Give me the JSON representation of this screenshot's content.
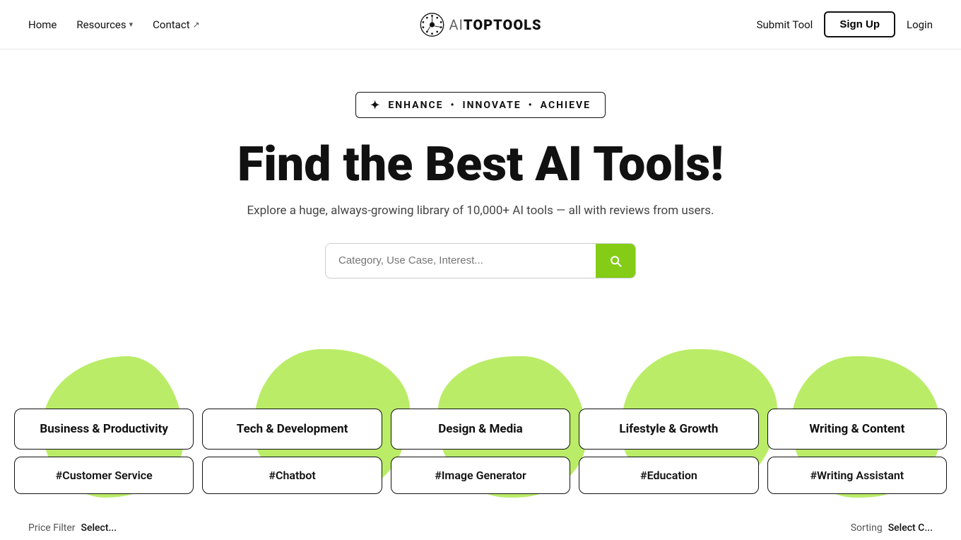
{
  "nav": {
    "home_label": "Home",
    "resources_label": "Resources",
    "contact_label": "Contact",
    "submit_tool_label": "Submit Tool",
    "signup_label": "Sign Up",
    "login_label": "Login",
    "logo_text": "AITOPTOOLS"
  },
  "hero": {
    "badge_icon": "✦",
    "badge_word1": "ENHANCE",
    "badge_dot1": "•",
    "badge_word2": "INNOVATE",
    "badge_dot2": "•",
    "badge_word3": "ACHIEVE",
    "title": "Find the Best AI Tools!",
    "subtitle": "Explore a huge, always-growing library of 10,000+ AI tools — all with reviews from users.",
    "search_placeholder": "Category, Use Case, Interest..."
  },
  "categories": {
    "row1": [
      {
        "label": "Business & Productivity"
      },
      {
        "label": "Tech & Development"
      },
      {
        "label": "Design & Media"
      },
      {
        "label": "Lifestyle & Growth"
      },
      {
        "label": "Writing & Content"
      }
    ],
    "row2": [
      {
        "label": "#Customer Service"
      },
      {
        "label": "#Chatbot"
      },
      {
        "label": "#Image Generator"
      },
      {
        "label": "#Education"
      },
      {
        "label": "#Writing Assistant"
      }
    ]
  },
  "bottom_bar": {
    "price_filter_label": "Price Filter",
    "price_filter_value": "Select...",
    "sorting_label": "Sorting",
    "sorting_value": "Select C..."
  }
}
